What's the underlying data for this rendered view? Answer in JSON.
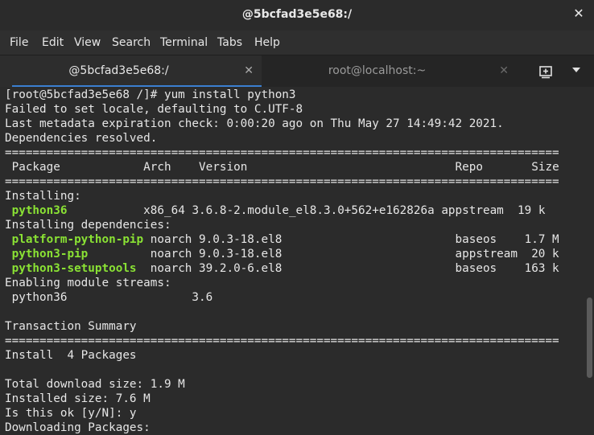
{
  "window": {
    "title": "@5bcfad3e5e68:/",
    "close_glyph": "✕"
  },
  "menu": [
    "File",
    "Edit",
    "View",
    "Search",
    "Terminal",
    "Tabs",
    "Help"
  ],
  "tabs": [
    {
      "label": "@5bcfad3e5e68:/",
      "close_glyph": "✕",
      "active": true
    },
    {
      "label": "root@localhost:~",
      "close_glyph": "✕",
      "active": false
    }
  ],
  "icons": {
    "new_tab": "new-tab-icon",
    "tab_menu": "chevron-down-icon"
  },
  "colors": {
    "package_name": "#8ae234",
    "active_tab_underline": "#3b7fd0"
  },
  "terminal": {
    "prompt": "[root@5bcfad3e5e68 /]# yum install python3",
    "locale_warning": "Failed to set locale, defaulting to C.UTF-8",
    "metadata_check": "Last metadata expiration check: 0:00:20 ago on Thu May 27 14:49:42 2021.",
    "deps_resolved": "Dependencies resolved.",
    "separator": "================================================================================",
    "columns": {
      "package": "Package",
      "arch": "Arch",
      "version": "Version",
      "repo": "Repo",
      "size": "Size"
    },
    "section_installing": "Installing:",
    "installing": [
      {
        "name": "python36",
        "arch": "x86_64",
        "version": "3.6.8-2.module_el8.3.0+562+e162826a",
        "repo": "appstream",
        "size": "19 k"
      }
    ],
    "section_deps": "Installing dependencies:",
    "dependencies": [
      {
        "name": "platform-python-pip",
        "arch": "noarch",
        "version": "9.0.3-18.el8",
        "repo": "baseos",
        "size": "1.7 M"
      },
      {
        "name": "python3-pip",
        "arch": "noarch",
        "version": "9.0.3-18.el8",
        "repo": "appstream",
        "size": "20 k"
      },
      {
        "name": "python3-setuptools",
        "arch": "noarch",
        "version": "39.2.0-6.el8",
        "repo": "baseos",
        "size": "163 k"
      }
    ],
    "section_streams": "Enabling module streams:",
    "module_stream": {
      "name": "python36",
      "version": "3.6"
    },
    "transaction_summary": "Transaction Summary",
    "install_count": "Install  4 Packages",
    "download_size": "Total download size: 1.9 M",
    "installed_size": "Installed size: 7.6 M",
    "confirm": "Is this ok [y/N]: y",
    "downloading": "Downloading Packages:"
  }
}
